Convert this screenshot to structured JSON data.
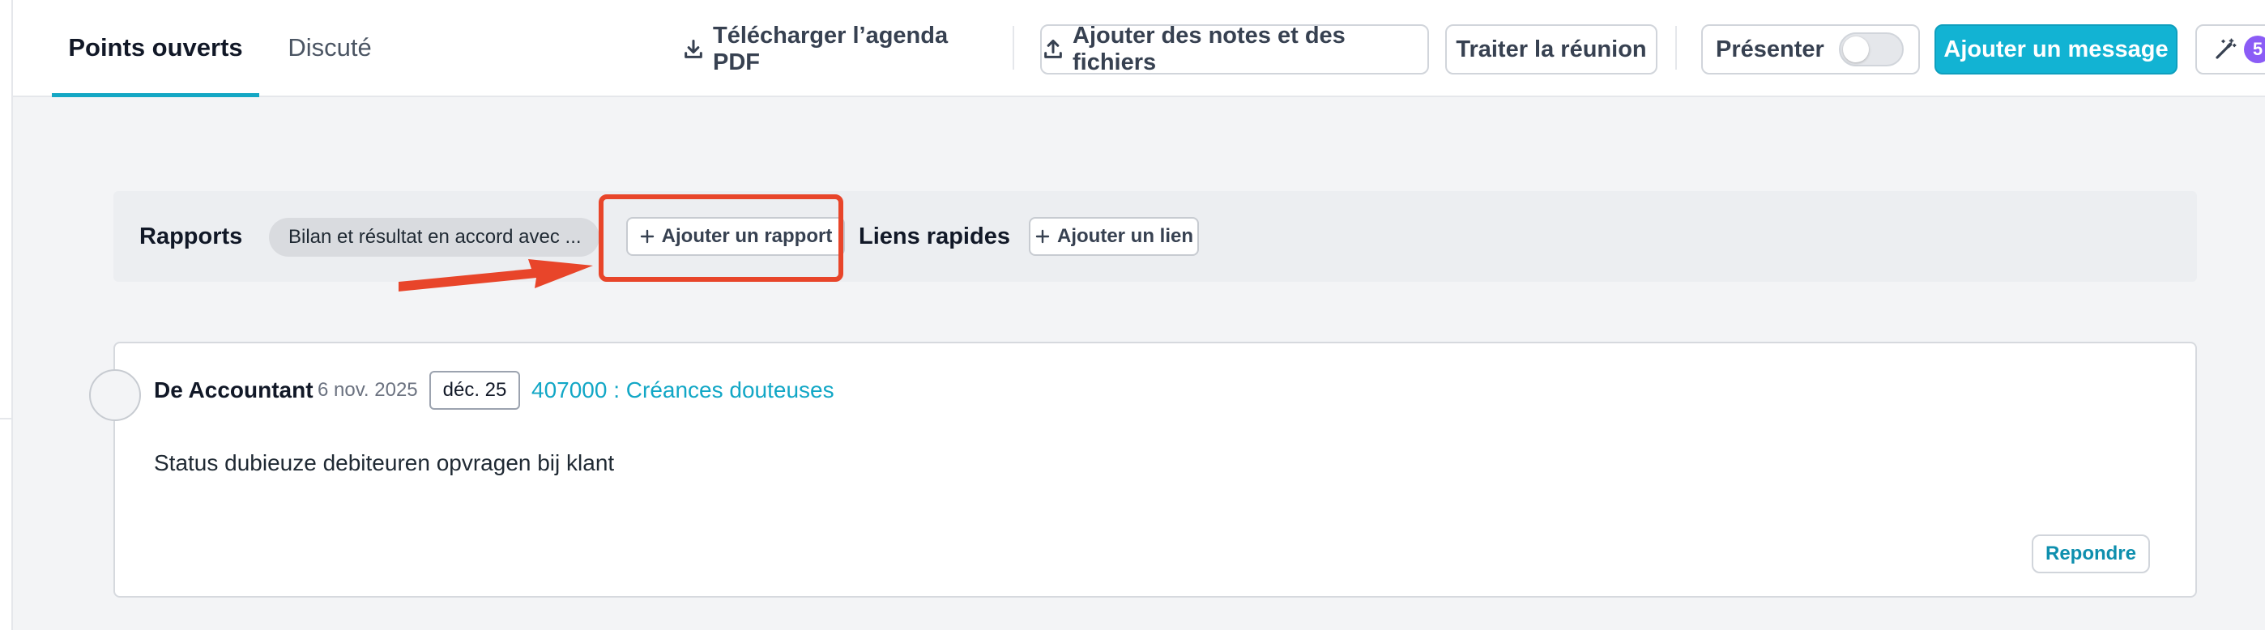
{
  "tabs": {
    "open_points": "Points ouverts",
    "discussed": "Discuté"
  },
  "toolbar": {
    "download_pdf": "Télécharger l’agenda PDF",
    "add_notes_files": "Ajouter des notes et des fichiers",
    "process_meeting": "Traiter la réunion",
    "present": "Présenter",
    "present_toggle_on": false,
    "add_message": "Ajouter un message",
    "ai_badge_count": "5"
  },
  "reports": {
    "label": "Rapports",
    "report_chip": "Bilan et résultat en accord avec ...",
    "add_report": "Ajouter un rapport",
    "quick_links_label": "Liens rapides",
    "add_link": "Ajouter un lien"
  },
  "message": {
    "author": "De Accountant",
    "date": "6 nov. 2025",
    "period": "déc. 25",
    "account_link": "407000 : Créances douteuses",
    "body": "Status dubieuze debiteuren opvragen bij klant",
    "reply": "Repondre"
  },
  "colors": {
    "accent": "#12b3d3",
    "highlight": "#e8452a",
    "badge": "#8b5cf6"
  }
}
